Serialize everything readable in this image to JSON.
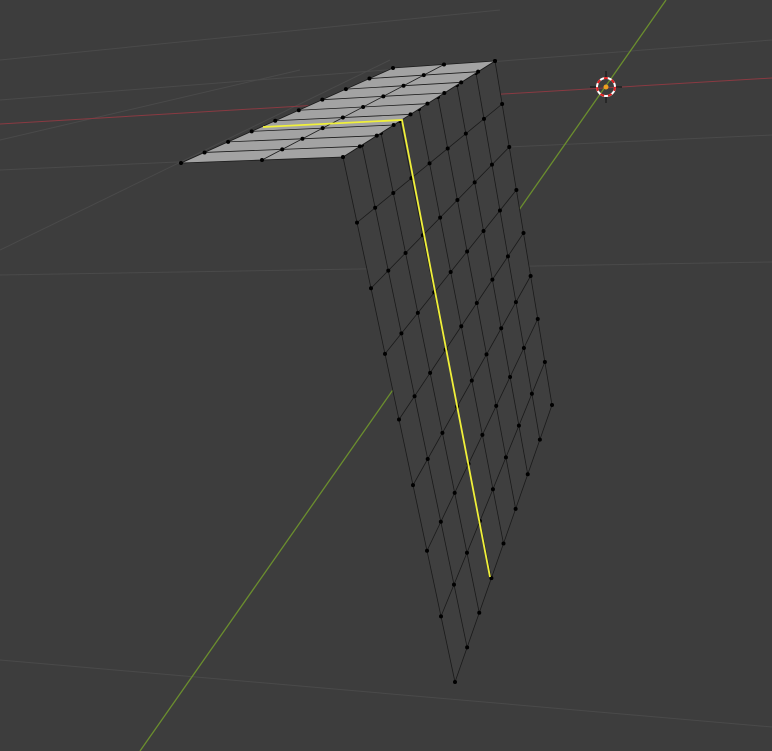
{
  "viewport": {
    "background_color": "#3d3d3d",
    "grid_color": "#4a4a4a",
    "x_axis_color": "#8a3a42",
    "y_axis_color": "#6b8e2e",
    "face_color_top": "#a3a3a3",
    "face_color_side": "#3f3f3f",
    "edge_color": "#1a1a1a",
    "selected_edge_color": "#f0f03a",
    "vertex_color": "#000000",
    "cursor_icon": "3d-cursor-icon"
  }
}
